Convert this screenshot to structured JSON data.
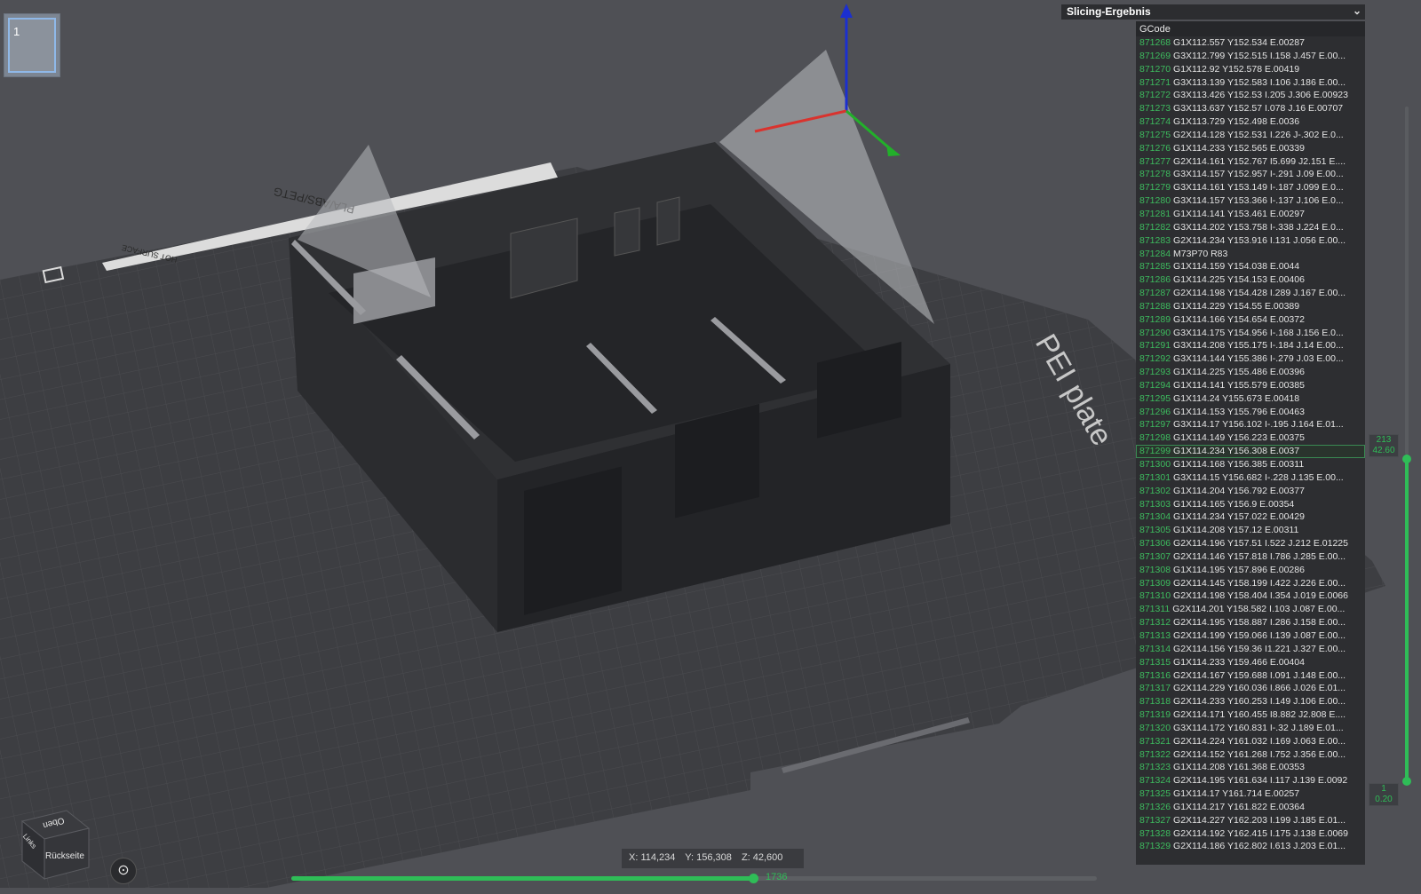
{
  "plate_thumbnail": {
    "number": "1"
  },
  "panel": {
    "title": "Slicing-Ergebnis"
  },
  "gcode": {
    "title": "GCode",
    "active_line": "871299",
    "lines": [
      {
        "n": "871268",
        "c": "G1X112.557 Y152.534 E.00287"
      },
      {
        "n": "871269",
        "c": "G3X112.799 Y152.515 I.158 J.457 E.00..."
      },
      {
        "n": "871270",
        "c": "G1X112.92 Y152.578 E.00419"
      },
      {
        "n": "871271",
        "c": "G3X113.139 Y152.583 I.106 J.186 E.00..."
      },
      {
        "n": "871272",
        "c": "G3X113.426 Y152.53 I.205 J.306 E.00923"
      },
      {
        "n": "871273",
        "c": "G3X113.637 Y152.57 I.078 J.16 E.00707"
      },
      {
        "n": "871274",
        "c": "G1X113.729 Y152.498 E.0036"
      },
      {
        "n": "871275",
        "c": "G2X114.128 Y152.531 I.226 J-.302 E.0..."
      },
      {
        "n": "871276",
        "c": "G1X114.233 Y152.565 E.00339"
      },
      {
        "n": "871277",
        "c": "G2X114.161 Y152.767 I5.699 J2.151 E...."
      },
      {
        "n": "871278",
        "c": "G3X114.157 Y152.957 I-.291 J.09 E.00..."
      },
      {
        "n": "871279",
        "c": "G3X114.161 Y153.149 I-.187 J.099 E.0..."
      },
      {
        "n": "871280",
        "c": "G3X114.157 Y153.366 I-.137 J.106 E.0..."
      },
      {
        "n": "871281",
        "c": "G1X114.141 Y153.461 E.00297"
      },
      {
        "n": "871282",
        "c": "G3X114.202 Y153.758 I-.338 J.224 E.0..."
      },
      {
        "n": "871283",
        "c": "G2X114.234 Y153.916 I.131 J.056 E.00..."
      },
      {
        "n": "871284",
        "c": "M73P70 R83"
      },
      {
        "n": "871285",
        "c": "G1X114.159 Y154.038 E.0044"
      },
      {
        "n": "871286",
        "c": "G1X114.225 Y154.153 E.00406"
      },
      {
        "n": "871287",
        "c": "G2X114.198 Y154.428 I.289 J.167 E.00..."
      },
      {
        "n": "871288",
        "c": "G1X114.229 Y154.55 E.00389"
      },
      {
        "n": "871289",
        "c": "G1X114.166 Y154.654 E.00372"
      },
      {
        "n": "871290",
        "c": "G3X114.175 Y154.956 I-.168 J.156 E.0..."
      },
      {
        "n": "871291",
        "c": "G3X114.208 Y155.175 I-.184 J.14 E.00..."
      },
      {
        "n": "871292",
        "c": "G3X114.144 Y155.386 I-.279 J.03 E.00..."
      },
      {
        "n": "871293",
        "c": "G1X114.225 Y155.486 E.00396"
      },
      {
        "n": "871294",
        "c": "G1X114.141 Y155.579 E.00385"
      },
      {
        "n": "871295",
        "c": "G1X114.24 Y155.673 E.00418"
      },
      {
        "n": "871296",
        "c": "G1X114.153 Y155.796 E.00463"
      },
      {
        "n": "871297",
        "c": "G3X114.17 Y156.102 I-.195 J.164 E.01..."
      },
      {
        "n": "871298",
        "c": "G1X114.149 Y156.223 E.00375"
      },
      {
        "n": "871299",
        "c": "G1X114.234 Y156.308 E.0037"
      },
      {
        "n": "871300",
        "c": "G1X114.168 Y156.385 E.00311"
      },
      {
        "n": "871301",
        "c": "G3X114.15 Y156.682 I-.228 J.135 E.00..."
      },
      {
        "n": "871302",
        "c": "G1X114.204 Y156.792 E.00377"
      },
      {
        "n": "871303",
        "c": "G1X114.165 Y156.9 E.00354"
      },
      {
        "n": "871304",
        "c": "G1X114.234 Y157.022 E.00429"
      },
      {
        "n": "871305",
        "c": "G1X114.208 Y157.12 E.00311"
      },
      {
        "n": "871306",
        "c": "G2X114.196 Y157.51 I.522 J.212 E.01225"
      },
      {
        "n": "871307",
        "c": "G2X114.146 Y157.818 I.786 J.285 E.00..."
      },
      {
        "n": "871308",
        "c": "G1X114.195 Y157.896 E.00286"
      },
      {
        "n": "871309",
        "c": "G2X114.145 Y158.199 I.422 J.226 E.00..."
      },
      {
        "n": "871310",
        "c": "G2X114.198 Y158.404 I.354 J.019 E.0066"
      },
      {
        "n": "871311",
        "c": "G2X114.201 Y158.582 I.103 J.087 E.00..."
      },
      {
        "n": "871312",
        "c": "G2X114.195 Y158.887 I.286 J.158 E.00..."
      },
      {
        "n": "871313",
        "c": "G2X114.199 Y159.066 I.139 J.087 E.00..."
      },
      {
        "n": "871314",
        "c": "G2X114.156 Y159.36 I1.221 J.327 E.00..."
      },
      {
        "n": "871315",
        "c": "G1X114.233 Y159.466 E.00404"
      },
      {
        "n": "871316",
        "c": "G2X114.167 Y159.688 I.091 J.148 E.00..."
      },
      {
        "n": "871317",
        "c": "G2X114.229 Y160.036 I.866 J.026 E.01..."
      },
      {
        "n": "871318",
        "c": "G2X114.233 Y160.253 I.149 J.106 E.00..."
      },
      {
        "n": "871319",
        "c": "G2X114.171 Y160.455 I8.882 J2.808 E...."
      },
      {
        "n": "871320",
        "c": "G3X114.172 Y160.831 I-.32 J.189 E.01..."
      },
      {
        "n": "871321",
        "c": "G2X114.224 Y161.032 I.169 J.063 E.00..."
      },
      {
        "n": "871322",
        "c": "G2X114.152 Y161.268 I.752 J.356 E.00..."
      },
      {
        "n": "871323",
        "c": "G1X114.208 Y161.368 E.00353"
      },
      {
        "n": "871324",
        "c": "G2X114.195 Y161.634 I.117 J.139 E.0092"
      },
      {
        "n": "871325",
        "c": "G1X114.17 Y161.714 E.00257"
      },
      {
        "n": "871326",
        "c": "G1X114.217 Y161.822 E.00364"
      },
      {
        "n": "871327",
        "c": "G2X114.227 Y162.203 I.199 J.185 E.01..."
      },
      {
        "n": "871328",
        "c": "G2X114.192 Y162.415 I.175 J.138 E.0069"
      },
      {
        "n": "871329",
        "c": "G2X114.186 Y162.802 I.613 J.203 E.01..."
      }
    ]
  },
  "layer_slider": {
    "top_layer": "213",
    "top_height": "42.60",
    "bottom_layer": "1",
    "bottom_height": "0.20"
  },
  "move_slider": {
    "value": "1736"
  },
  "coordinates": {
    "x": "X: 114,234",
    "y": "Y: 156,308",
    "z": "Z: 42,600"
  },
  "plate": {
    "label": "PEI plate",
    "badge": "PLA/ABS/PETG",
    "warning": "HOT SURFACE"
  },
  "view_cube": {
    "top": "Oben",
    "back": "Rückseite",
    "left": "Links"
  },
  "colors": {
    "accent": "#2fbd57",
    "axis_x": "#d9332e",
    "axis_y": "#22b02a",
    "axis_z": "#1b2fd0"
  }
}
